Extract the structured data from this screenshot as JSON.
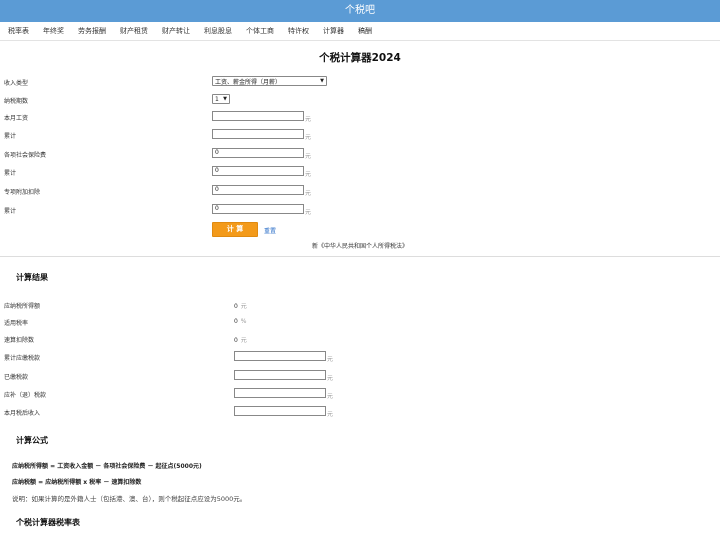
{
  "site": {
    "title": "个税吧"
  },
  "nav": [
    "税率表",
    "年终奖",
    "劳务报酬",
    "财产租赁",
    "财产转让",
    "利息股息",
    "个体工商",
    "特许权",
    "计算器",
    "稿酬"
  ],
  "page_title": "个税计算器2024",
  "form": {
    "income_type": {
      "label": "收入类型",
      "value": "工资、薪金所得（月薪）"
    },
    "periods": {
      "label": "纳税期数",
      "value": "1"
    },
    "salary": {
      "label": "本月工资",
      "value": "",
      "unit": "元"
    },
    "salary_cum": {
      "label": "累计",
      "value": "",
      "unit": "元"
    },
    "insurance": {
      "label": "各项社会保险费",
      "value": "0",
      "unit": "元"
    },
    "insurance_cum": {
      "label": "累计",
      "value": "0",
      "unit": "元"
    },
    "special": {
      "label": "专项附加扣除",
      "value": "0",
      "unit": "元"
    },
    "special_cum": {
      "label": "累计",
      "value": "0",
      "unit": "元"
    },
    "calc_button": "计 算",
    "reset_link": "重置",
    "law_link": "新《中华人民共和国个人所得税法》"
  },
  "results": {
    "heading": "计算结果",
    "taxable": {
      "label": "应纳税所得额",
      "value": "0",
      "unit": "元"
    },
    "rate": {
      "label": "适用税率",
      "value": "0",
      "unit": "%"
    },
    "deduction": {
      "label": "速算扣除数",
      "value": "0",
      "unit": "元"
    },
    "cum_tax": {
      "label": "累计应缴税款",
      "value": "",
      "unit": "元"
    },
    "paid_tax": {
      "label": "已缴税款",
      "value": "",
      "unit": "元"
    },
    "refund": {
      "label": "应补（退）税款",
      "value": "",
      "unit": "元"
    },
    "after_tax": {
      "label": "本月税后收入",
      "value": "",
      "unit": "元"
    }
  },
  "formula": {
    "heading": "计算公式",
    "line1": "应纳税所得额 = 工资收入金额 － 各项社会保险费 － 起征点(5000元)",
    "line2": "应纳税额 = 应纳税所得额 x 税率 － 速算扣除数",
    "note": "说明：如果计算的是外籍人士（包括港、澳、台），则个税起征点应设为5000元。"
  },
  "rate_table": {
    "heading": "个税计算器税率表"
  },
  "colors": {
    "topbar": "#5b9bd5",
    "button": "#f39a1a",
    "link": "#2a6ec8"
  }
}
